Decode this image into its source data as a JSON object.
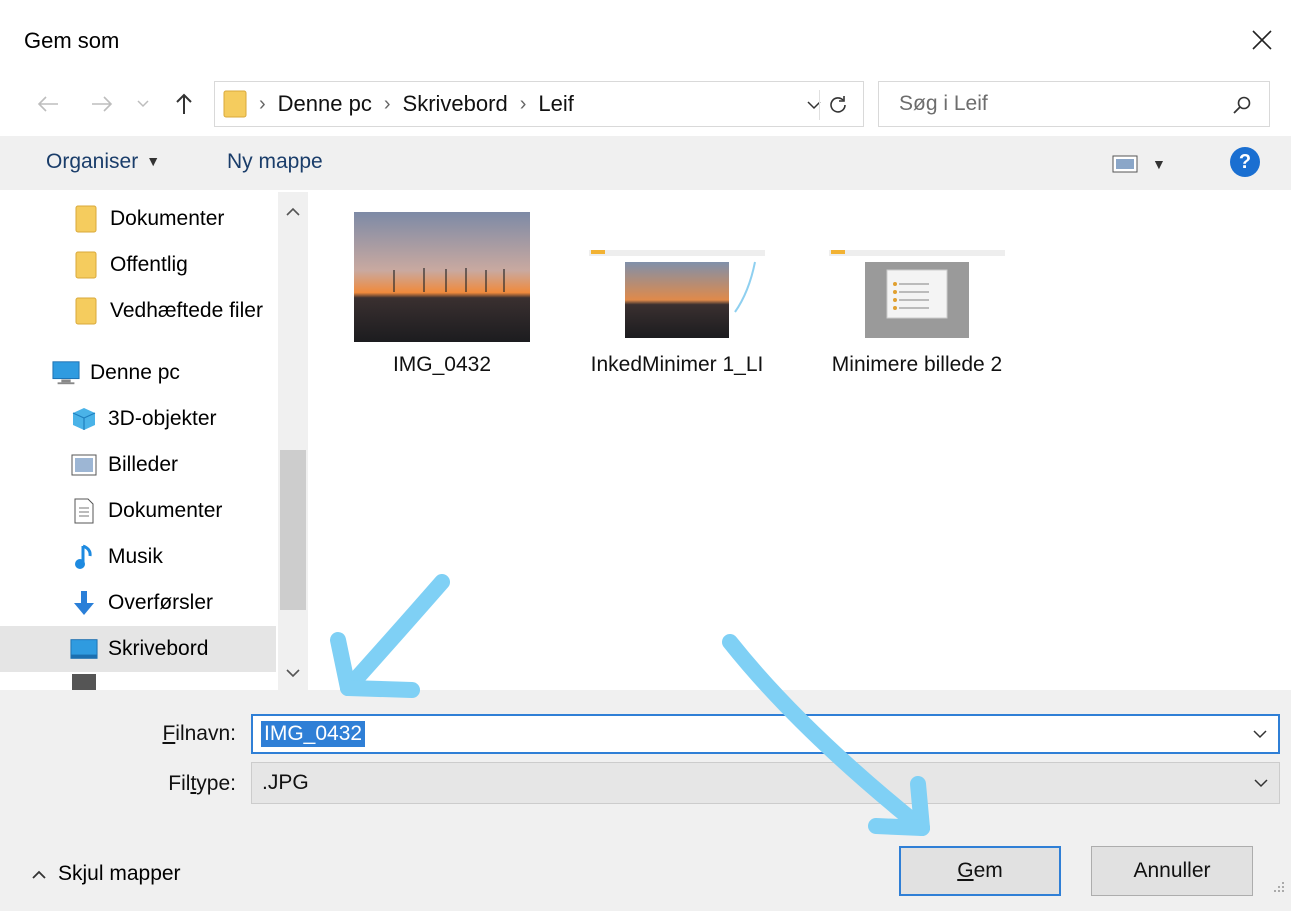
{
  "window": {
    "title": "Gem som"
  },
  "address": {
    "crumbs": [
      "Denne pc",
      "Skrivebord",
      "Leif"
    ]
  },
  "search": {
    "placeholder": "Søg i Leif"
  },
  "toolbar": {
    "organise": "Organiser",
    "new_folder": "Ny mappe"
  },
  "navpane": {
    "items": [
      {
        "label": "Dokumenter",
        "icon": "folder-icon"
      },
      {
        "label": "Offentlig",
        "icon": "folder-icon"
      },
      {
        "label": "Vedhæftede filer",
        "icon": "folder-icon"
      },
      {
        "label": "Denne pc",
        "icon": "computer-icon"
      },
      {
        "label": "3D-objekter",
        "icon": "cube-3d-icon"
      },
      {
        "label": "Billeder",
        "icon": "pictures-icon"
      },
      {
        "label": "Dokumenter",
        "icon": "documents-icon"
      },
      {
        "label": "Musik",
        "icon": "music-note-icon"
      },
      {
        "label": "Overførsler",
        "icon": "download-arrow-icon"
      },
      {
        "label": "Skrivebord",
        "icon": "desktop-icon",
        "selected": true
      }
    ]
  },
  "files": [
    {
      "name": "IMG_0432"
    },
    {
      "name": "InkedMinimer 1_LI"
    },
    {
      "name": "Minimere billede 2"
    }
  ],
  "form": {
    "filename_label_u": "F",
    "filename_label_rest": "ilnavn:",
    "filename_value": "IMG_0432",
    "filetype_label_pre": "Fil",
    "filetype_label_u": "t",
    "filetype_label_rest": "ype:",
    "filetype_value": ".JPG"
  },
  "footer": {
    "hide_folders": "Skjul mapper",
    "save_u": "G",
    "save_rest": "em",
    "cancel": "Annuller"
  },
  "colors": {
    "accent": "#2f7fd6",
    "annotation_arrow": "#7fd0f5",
    "toolbar_bg": "#f0f0f0",
    "selected_bg": "#e5e5e5"
  }
}
